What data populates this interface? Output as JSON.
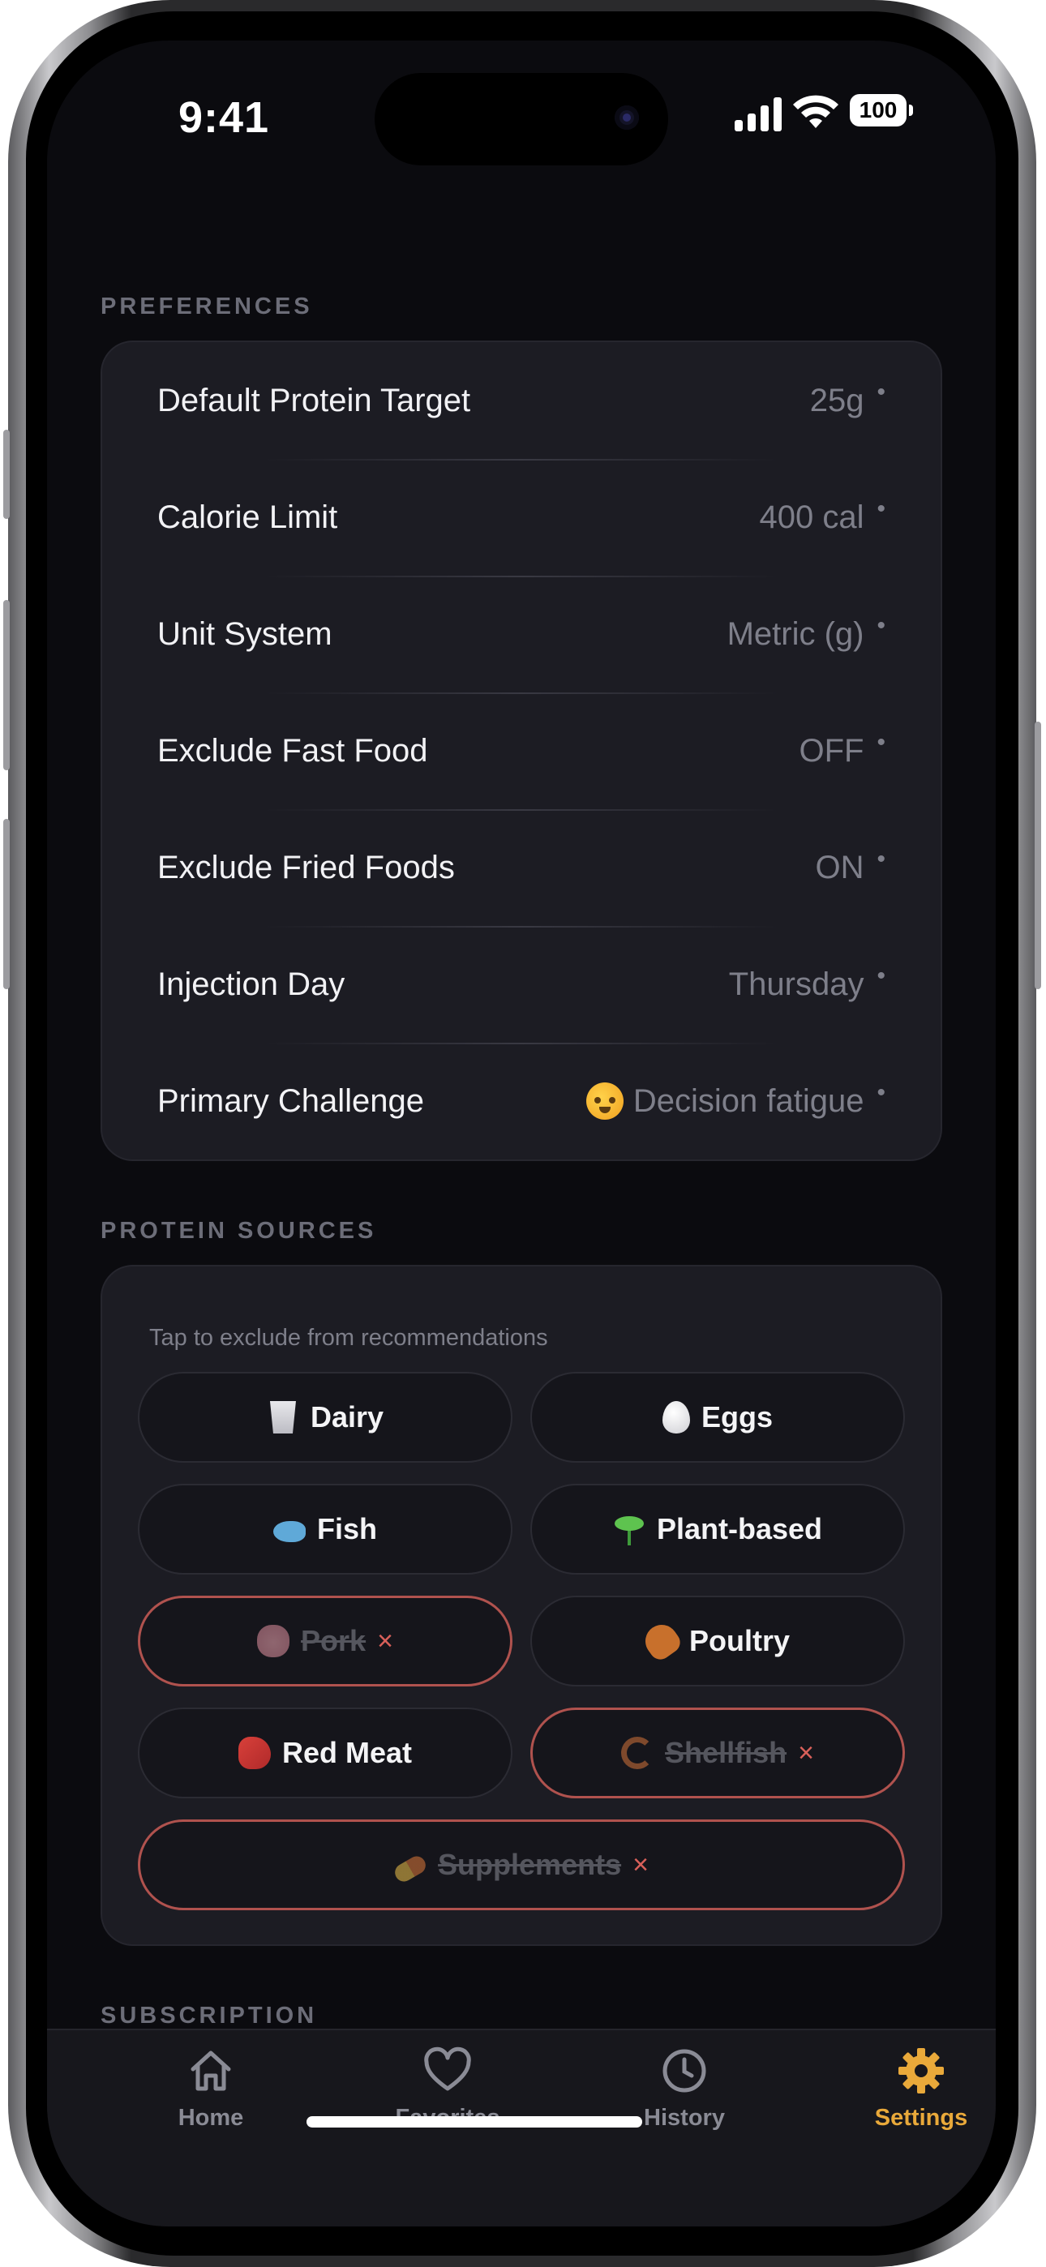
{
  "status_bar": {
    "time": "9:41",
    "battery": "100"
  },
  "preferences": {
    "header": "PREFERENCES",
    "rows": [
      {
        "label": "Default Protein Target",
        "value": "25g"
      },
      {
        "label": "Calorie Limit",
        "value": "400 cal"
      },
      {
        "label": "Unit System",
        "value": "Metric (g)"
      },
      {
        "label": "Exclude Fast Food",
        "value": "OFF"
      },
      {
        "label": "Exclude Fried Foods",
        "value": "ON"
      },
      {
        "label": "Injection Day",
        "value": "Thursday"
      },
      {
        "label": "Primary Challenge",
        "value": "Decision fatigue",
        "icon": "exploding-head-emoji"
      }
    ]
  },
  "protein_sources": {
    "header": "PROTEIN SOURCES",
    "hint": "Tap to exclude from recommendations",
    "excluded_mark": "×",
    "chips": [
      {
        "label": "Dairy",
        "icon": "milk-icon",
        "excluded": false
      },
      {
        "label": "Eggs",
        "icon": "egg-icon",
        "excluded": false
      },
      {
        "label": "Fish",
        "icon": "fish-icon",
        "excluded": false
      },
      {
        "label": "Plant-based",
        "icon": "seedling-icon",
        "excluded": false
      },
      {
        "label": "Pork",
        "icon": "pig-icon",
        "excluded": true
      },
      {
        "label": "Poultry",
        "icon": "poultry-leg-icon",
        "excluded": false
      },
      {
        "label": "Red Meat",
        "icon": "meat-icon",
        "excluded": false
      },
      {
        "label": "Shellfish",
        "icon": "shrimp-icon",
        "excluded": true
      },
      {
        "label": "Supplements",
        "icon": "pill-icon",
        "excluded": true
      }
    ]
  },
  "subscription": {
    "header": "SUBSCRIPTION"
  },
  "tab_bar": {
    "active_color": "#e9a93a",
    "tabs": [
      {
        "label": "Home",
        "icon": "home-icon"
      },
      {
        "label": "Favorites",
        "icon": "heart-icon"
      },
      {
        "label": "History",
        "icon": "clock-icon"
      },
      {
        "label": "Settings",
        "icon": "gear-icon",
        "active": true
      }
    ]
  }
}
